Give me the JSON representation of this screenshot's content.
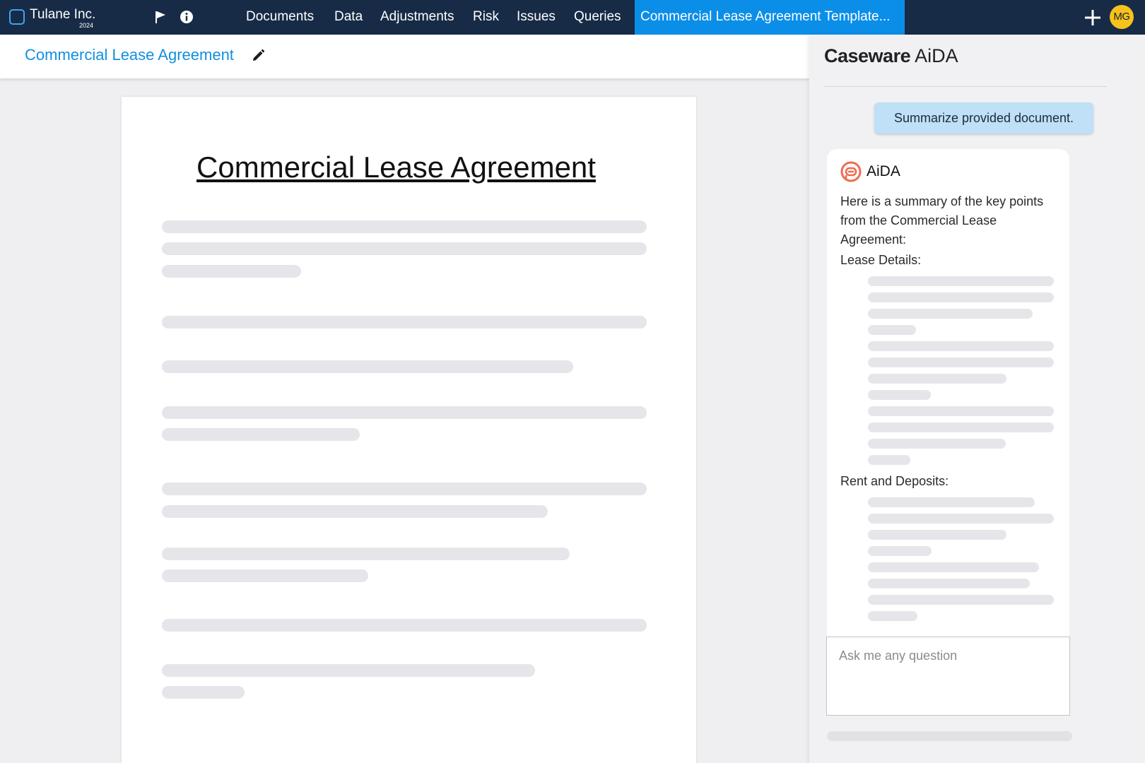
{
  "topbar": {
    "company": "Tulane Inc.",
    "year": "2024",
    "tabs": [
      {
        "label": "Documents"
      },
      {
        "label": "Data"
      },
      {
        "label": "Adjustments"
      },
      {
        "label": "Risk"
      },
      {
        "label": "Issues"
      },
      {
        "label": "Queries"
      },
      {
        "label": "Commercial Lease Agreement Template..."
      }
    ],
    "avatar_initials": "MG",
    "colors": {
      "bar": "#172b47",
      "active_tab": "#0b8ee8",
      "avatar": "#f7c21b"
    },
    "icons": [
      "flag-icon",
      "info-icon",
      "plus-icon"
    ]
  },
  "doc_header": {
    "title": "Commercial Lease Agreement",
    "icon": "pencil-icon"
  },
  "document": {
    "heading": "Commercial Lease Agreement"
  },
  "panel": {
    "brand_bold": "Caseware",
    "brand_regular": " AiDA",
    "user_message": "Summarize provided document.",
    "assistant_name": "AiDA",
    "assistant_intro": "Here is a summary of the key points from the Commercial Lease Agreement:",
    "section_1": "Lease Details:",
    "section_2": "Rent and Deposits:",
    "input_placeholder": "Ask me any question",
    "colors": {
      "user_bubble": "#bfe0f6",
      "ai_logo": "#f26b4f"
    }
  }
}
